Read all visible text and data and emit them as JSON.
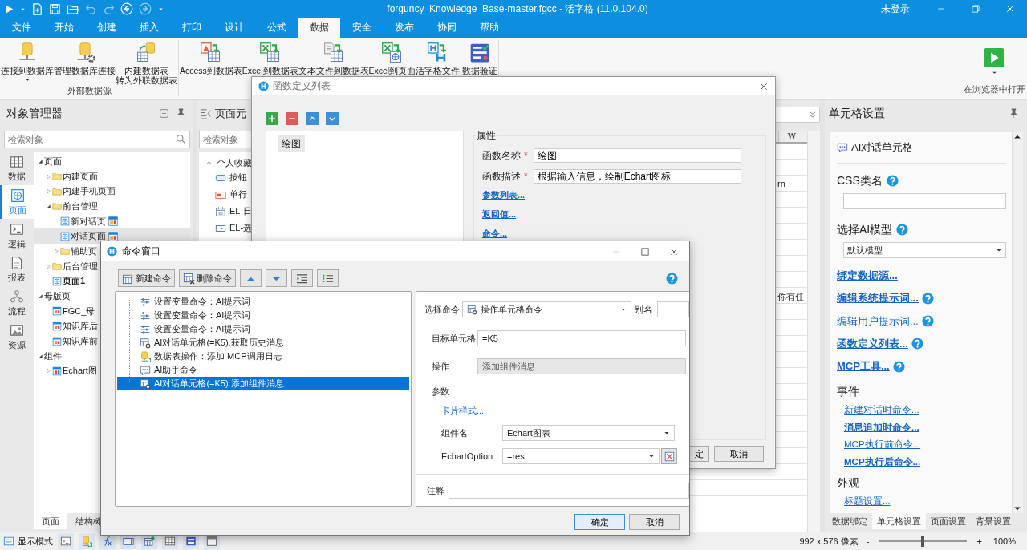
{
  "window": {
    "title": "forguncy_Knowledge_Base-master.fgcc - 活字格 (11.0.104.0)",
    "user": "未登录"
  },
  "menu_tabs": [
    {
      "label": "文件",
      "selected": false
    },
    {
      "label": "开始",
      "selected": false
    },
    {
      "label": "创建",
      "selected": false
    },
    {
      "label": "插入",
      "selected": false
    },
    {
      "label": "打印",
      "selected": false
    },
    {
      "label": "设计",
      "selected": false
    },
    {
      "label": "公式",
      "selected": false
    },
    {
      "label": "数据",
      "selected": true
    },
    {
      "label": "安全",
      "selected": false
    },
    {
      "label": "发布",
      "selected": false
    },
    {
      "label": "协同",
      "selected": false
    },
    {
      "label": "帮助",
      "selected": false
    }
  ],
  "ribbon": {
    "groups": [
      {
        "label": "外部数据源",
        "buttons": [
          {
            "kind": "db-connect",
            "lines": [
              "连接到数据库"
            ],
            "dropdown": true
          },
          {
            "kind": "db-manage",
            "lines": [
              "管理数据库连接"
            ],
            "dropdown": false
          },
          {
            "kind": "db-convert",
            "lines": [
              "内建数据表",
              "转为外联数据表"
            ],
            "dropdown": false
          }
        ]
      },
      {
        "buttons": [
          {
            "kind": "access",
            "lines": [
              "Access到数据表"
            ],
            "dropdown": false
          },
          {
            "kind": "excel",
            "lines": [
              "Excel到数据表"
            ],
            "dropdown": false
          },
          {
            "kind": "text",
            "lines": [
              "文本文件到数据表"
            ],
            "dropdown": false
          },
          {
            "kind": "excel-page",
            "lines": [
              "Excel到页面"
            ],
            "dropdown": false
          },
          {
            "kind": "hzg",
            "lines": [
              "活字格文件"
            ],
            "dropdown": false
          }
        ]
      },
      {
        "buttons": [
          {
            "kind": "validate",
            "lines": [
              "数据验证"
            ],
            "dropdown": false
          }
        ]
      }
    ],
    "run": {
      "label": "在浏览器中打开",
      "dropdown": true
    }
  },
  "object_manager": {
    "title": "对象管理器",
    "search": {
      "placeholder": "检索对象"
    },
    "nav": [
      {
        "label": "数据",
        "kind": "grid",
        "selected": false
      },
      {
        "label": "页面",
        "kind": "page",
        "selected": true
      },
      {
        "label": "逻辑",
        "kind": "terminal",
        "selected": false
      },
      {
        "label": "报表",
        "kind": "report",
        "selected": false
      },
      {
        "label": "流程",
        "kind": "flow",
        "selected": false
      },
      {
        "label": "资源",
        "kind": "image",
        "selected": false
      }
    ],
    "tree": [
      {
        "label": "页面",
        "expanded": true,
        "selected": false,
        "children": [
          {
            "label": "内建页面",
            "kind": "folder",
            "expanded": false,
            "selected": false
          },
          {
            "label": "内建手机页面",
            "kind": "folder",
            "expanded": false,
            "selected": false
          },
          {
            "label": "前台管理",
            "kind": "folder",
            "expanded": true,
            "selected": false,
            "children": [
              {
                "label": "新对话页",
                "kind": "page",
                "flag": true,
                "start": false,
                "selected": false
              },
              {
                "label": "对话页面",
                "kind": "page",
                "flag": true,
                "start": false,
                "selected": true
              },
              {
                "label": "辅助页",
                "kind": "folder",
                "expanded": false,
                "selected": false
              }
            ]
          },
          {
            "label": "后台管理",
            "kind": "folder",
            "expanded": false,
            "selected": false
          },
          {
            "label": "页面1",
            "kind": "page",
            "flag": false,
            "start": true,
            "selected": false
          }
        ]
      },
      {
        "label": "母版页",
        "expanded": true,
        "selected": false,
        "children": [
          {
            "label": "FGC_母",
            "kind": "master",
            "selected": false
          },
          {
            "label": "知识库后",
            "kind": "master",
            "selected": false
          },
          {
            "label": "知识库前",
            "kind": "master",
            "selected": false
          }
        ]
      },
      {
        "label": "组件",
        "expanded": true,
        "selected": false,
        "children": [
          {
            "label": "Echart图",
            "kind": "component",
            "expanded": false,
            "selected": false
          }
        ]
      }
    ],
    "tabs": [
      {
        "label": "页面",
        "selected": true
      },
      {
        "label": "结构树",
        "selected": false
      }
    ]
  },
  "page_elements": {
    "title": "页面元",
    "search": {
      "placeholder": "检索对象"
    },
    "section": {
      "label": "个人收藏",
      "expanded": true
    },
    "items": [
      {
        "label": "按钮",
        "kind": "button"
      },
      {
        "label": "单行",
        "kind": "textbox"
      },
      {
        "label": "EL-日",
        "kind": "date"
      },
      {
        "label": "EL-选",
        "kind": "select"
      }
    ]
  },
  "sheet": {
    "column": "W",
    "cells": [
      {
        "text": "rn"
      },
      {
        "text": "你有任"
      }
    ]
  },
  "cell_settings": {
    "title": "单元格设置",
    "cell_type": "AI对话单元格",
    "rows": [
      {
        "kind": "label",
        "text": "CSS类名",
        "help": true
      },
      {
        "kind": "field"
      },
      {
        "kind": "label",
        "text": "选择AI模型",
        "help": true
      },
      {
        "kind": "select",
        "value": "默认模型"
      },
      {
        "kind": "link",
        "text": "绑定数据源...",
        "bold": true,
        "help": false
      },
      {
        "kind": "link",
        "text": "编辑系统提示词...",
        "bold": true,
        "help": true
      },
      {
        "kind": "link",
        "text": "编辑用户提示词...",
        "bold": false,
        "help": true
      },
      {
        "kind": "link",
        "text": "函数定义列表...",
        "bold": true,
        "help": true
      },
      {
        "kind": "link",
        "text": "MCP工具...",
        "bold": true,
        "help": true
      },
      {
        "kind": "heading",
        "text": "事件"
      },
      {
        "kind": "sublink",
        "text": "新建对话时命令...",
        "bold": false
      },
      {
        "kind": "sublink",
        "text": "消息追加时命令...",
        "bold": true
      },
      {
        "kind": "sublink",
        "text": "MCP执行前命令...",
        "bold": false
      },
      {
        "kind": "sublink",
        "text": "MCP执行后命令...",
        "bold": true
      },
      {
        "kind": "heading",
        "text": "外观"
      },
      {
        "kind": "sublink",
        "text": "标题设置...",
        "bold": false
      }
    ],
    "tabs": [
      {
        "label": "数据绑定",
        "selected": false
      },
      {
        "label": "单元格设置",
        "selected": true
      },
      {
        "label": "页面设置",
        "selected": false
      },
      {
        "label": "背景设置",
        "selected": false
      }
    ]
  },
  "status_bar": {
    "mode": "显示模式",
    "size": "992 x 576 像素",
    "zoom": {
      "out": "-",
      "in": "+",
      "level": 0.5,
      "value": "100%"
    }
  },
  "function_dialog": {
    "title": "函数定义列表",
    "functions": [
      {
        "name": "绘图",
        "selected": true
      }
    ],
    "properties": {
      "title": "属性",
      "fields": [
        {
          "label": "函数名称",
          "mark": "*",
          "value": "绘图"
        },
        {
          "label": "函数描述",
          "mark": "*",
          "value": "根据输入信息，绘制Echart图标"
        }
      ],
      "links": [
        "参数列表...",
        "返回值...",
        "命令..."
      ]
    },
    "buttons": [
      "定",
      "取消"
    ]
  },
  "command_window": {
    "title": "命令窗口",
    "toolbar": [
      {
        "kind": "new",
        "label": "新建命令"
      },
      {
        "kind": "delete",
        "label": "删除命令"
      },
      {
        "kind": "up"
      },
      {
        "kind": "down"
      },
      {
        "kind": "indent"
      },
      {
        "kind": "list"
      }
    ],
    "commands": [
      {
        "kind": "variable",
        "label": "设置变量命令：AI提示词",
        "selected": false
      },
      {
        "kind": "variable",
        "label": "设置变量命令：AI提示词",
        "selected": false
      },
      {
        "kind": "variable",
        "label": "设置变量命令：AI提示词",
        "selected": false
      },
      {
        "kind": "cell",
        "label": "AI对话单元格(=K5).获取历史消息",
        "selected": false
      },
      {
        "kind": "table",
        "label": "数据表操作：添加 MCP调用日志",
        "selected": false
      },
      {
        "kind": "ai",
        "label": "AI助手命令",
        "selected": false
      },
      {
        "kind": "cell",
        "label": "AI对话单元格(=K5).添加组件消息",
        "selected": true
      }
    ],
    "detail": {
      "command_label": "选择命令:",
      "command": "操作单元格命令",
      "alias_label": "别名",
      "target_label": "目标单元格",
      "target": "=K5",
      "operation_label": "操作",
      "operation": "添加组件消息",
      "operation_disabled": true,
      "params_label": "参数",
      "card_link": "卡片样式...",
      "component_label": "组件名",
      "component": "Echart图表",
      "option_label": "EchartOption",
      "option": "=res",
      "note_label": "注释"
    },
    "buttons": [
      "确定",
      "取消"
    ]
  }
}
